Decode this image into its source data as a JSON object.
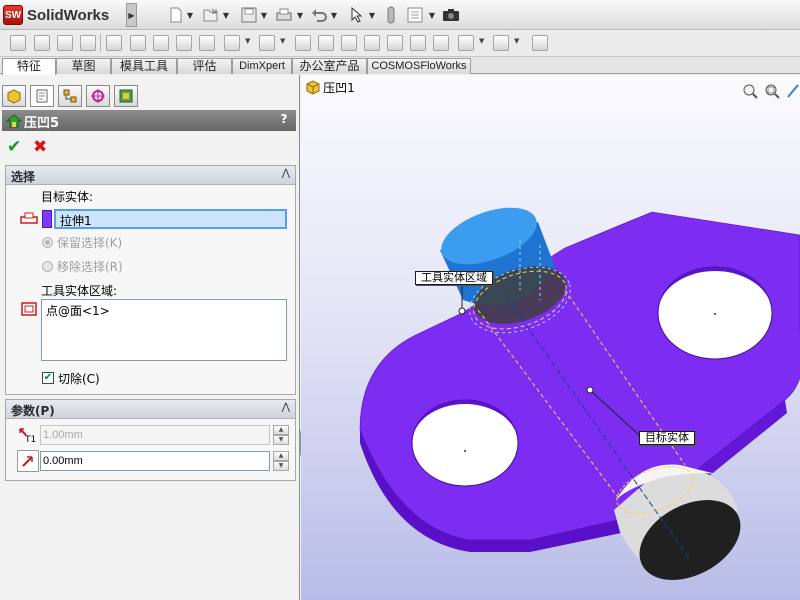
{
  "app": {
    "logo_badge": "SW",
    "logo_text": "SolidWorks"
  },
  "cm_tabs": [
    "特征",
    "草图",
    "模具工具",
    "评估",
    "DimXpert",
    "办公室产品",
    "COSMOSFloWorks"
  ],
  "feature": {
    "title": "压凹5",
    "help": "?",
    "ok": "✔",
    "cancel": "✖"
  },
  "selection": {
    "title": "选择",
    "target_label": "目标实体:",
    "target_value": "拉伸1",
    "keep_label": "保留选择(K)",
    "remove_label": "移除选择(R)",
    "tool_label": "工具实体区域:",
    "tool_value": "点@面<1>",
    "cut_label": "切除(C)",
    "cut_checked": true
  },
  "parameters": {
    "title": "参数(P)",
    "thickness": "1.00mm",
    "clearance": "0.00mm"
  },
  "viewport": {
    "tree_label": "压凹1",
    "tree_expand": "+",
    "callout_tool": "工具实体区域",
    "callout_target": "目标实体",
    "colors": {
      "plate_top": "#7d2cf2",
      "plate_side": "#5a10c9",
      "cylinder_top": "#2f8fe8",
      "cylinder_bottom": "#e9e9e9",
      "background_top": "#fbfbfe",
      "background_bottom": "#b9bce7"
    }
  },
  "icons": {
    "collapse": "⋀",
    "spin_up": "▲",
    "spin_down": "▼",
    "splitter": "◀",
    "arrow": "▾"
  }
}
